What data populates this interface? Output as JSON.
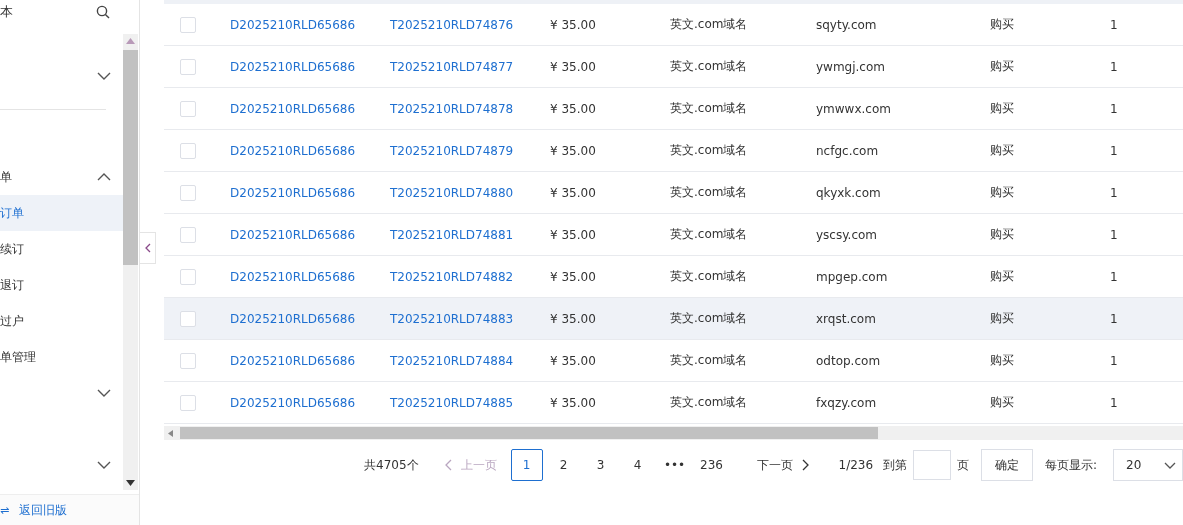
{
  "sidebar": {
    "items": [
      {
        "kind": "header",
        "label": "本"
      },
      {
        "kind": "group",
        "expanded": false
      },
      {
        "kind": "divider"
      },
      {
        "kind": "group",
        "label": "单",
        "expanded": true
      },
      {
        "kind": "link",
        "label": "订单",
        "selected": true
      },
      {
        "kind": "link",
        "label": "续订",
        "selected": false
      },
      {
        "kind": "link",
        "label": "退订",
        "selected": false
      },
      {
        "kind": "link",
        "label": "过户",
        "selected": false
      },
      {
        "kind": "link",
        "label": "单管理",
        "selected": false
      },
      {
        "kind": "group",
        "expanded": false
      },
      {
        "kind": "group",
        "expanded": false
      }
    ],
    "footer": {
      "icon": "⇌",
      "label": "返回旧版"
    }
  },
  "table": {
    "rows": [
      {
        "checked": false,
        "hovered": false,
        "cells": [
          "D2025210RLD65686",
          "T2025210RLD74876",
          "¥ 35.00",
          "英文.com域名",
          "sqyty.com",
          "购买",
          "1"
        ]
      },
      {
        "checked": false,
        "hovered": false,
        "cells": [
          "D2025210RLD65686",
          "T2025210RLD74877",
          "¥ 35.00",
          "英文.com域名",
          "ywmgj.com",
          "购买",
          "1"
        ]
      },
      {
        "checked": false,
        "hovered": false,
        "cells": [
          "D2025210RLD65686",
          "T2025210RLD74878",
          "¥ 35.00",
          "英文.com域名",
          "ymwwx.com",
          "购买",
          "1"
        ]
      },
      {
        "checked": false,
        "hovered": false,
        "cells": [
          "D2025210RLD65686",
          "T2025210RLD74879",
          "¥ 35.00",
          "英文.com域名",
          "ncfgc.com",
          "购买",
          "1"
        ]
      },
      {
        "checked": false,
        "hovered": false,
        "cells": [
          "D2025210RLD65686",
          "T2025210RLD74880",
          "¥ 35.00",
          "英文.com域名",
          "qkyxk.com",
          "购买",
          "1"
        ]
      },
      {
        "checked": false,
        "hovered": false,
        "cells": [
          "D2025210RLD65686",
          "T2025210RLD74881",
          "¥ 35.00",
          "英文.com域名",
          "yscsy.com",
          "购买",
          "1"
        ]
      },
      {
        "checked": false,
        "hovered": false,
        "cells": [
          "D2025210RLD65686",
          "T2025210RLD74882",
          "¥ 35.00",
          "英文.com域名",
          "mpgep.com",
          "购买",
          "1"
        ]
      },
      {
        "checked": false,
        "hovered": true,
        "cells": [
          "D2025210RLD65686",
          "T2025210RLD74883",
          "¥ 35.00",
          "英文.com域名",
          "xrqst.com",
          "购买",
          "1"
        ]
      },
      {
        "checked": false,
        "hovered": false,
        "cells": [
          "D2025210RLD65686",
          "T2025210RLD74884",
          "¥ 35.00",
          "英文.com域名",
          "odtop.com",
          "购买",
          "1"
        ]
      },
      {
        "checked": false,
        "hovered": false,
        "cells": [
          "D2025210RLD65686",
          "T2025210RLD74885",
          "¥ 35.00",
          "英文.com域名",
          "fxqzy.com",
          "购买",
          "1"
        ]
      }
    ]
  },
  "pagination": {
    "total": "共4705个",
    "prev": {
      "label": "上一页",
      "disabled": true
    },
    "pages": [
      {
        "label": "1",
        "selected": true
      },
      {
        "label": "2",
        "selected": false
      },
      {
        "label": "3",
        "selected": false
      },
      {
        "label": "4",
        "selected": false
      },
      {
        "label": "•••",
        "selected": false
      },
      {
        "label": "236",
        "selected": false
      }
    ],
    "next": {
      "label": "下一页",
      "disabled": false
    },
    "page_info": "1/236",
    "jump_prefix": "到第",
    "jump_suffix": "页",
    "confirm": "确定",
    "page_size_label": "每页显示:",
    "page_size": "20"
  }
}
